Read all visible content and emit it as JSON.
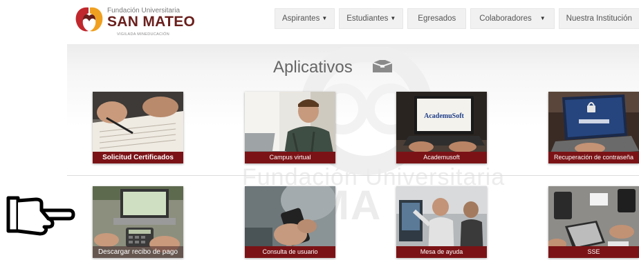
{
  "logo": {
    "small_line": "Fundación Universitaria",
    "big_line": "SAN MATEO",
    "tagline": "VIGILADA MINEDUCACIÓN"
  },
  "nav": [
    {
      "label": "Aspirantes",
      "dropdown": true
    },
    {
      "label": "Estudiantes",
      "dropdown": true
    },
    {
      "label": "Egresados",
      "dropdown": false
    },
    {
      "label": "Colaboradores",
      "dropdown": true
    },
    {
      "label": "Nuestra Institución",
      "dropdown": false
    }
  ],
  "section_title": "Aplicativos",
  "watermark": {
    "text": "Fundación Universitaria",
    "big": "MA"
  },
  "tiles": [
    {
      "label": "Solicitud Certificados",
      "icon": "document-signing-image"
    },
    {
      "label": "Campus virtual",
      "icon": "man-with-laptop-image"
    },
    {
      "label": "Academusoft",
      "icon": "laptop-academusoft-image",
      "screen_text": "AcademuSoft"
    },
    {
      "label": "Recuperación de contraseña",
      "icon": "laptop-lock-image"
    },
    {
      "label": "Descargar recibo de pago",
      "icon": "calculator-laptop-image"
    },
    {
      "label": "Consulta de usuario",
      "icon": "phone-in-hand-image"
    },
    {
      "label": "Mesa de ayuda",
      "icon": "office-meeting-image"
    },
    {
      "label": "SSE",
      "icon": "desk-devices-image"
    }
  ],
  "colors": {
    "brand": "#7b1316",
    "logo_text": "#6a1f1c",
    "nav_bg": "#f1f1f1"
  }
}
